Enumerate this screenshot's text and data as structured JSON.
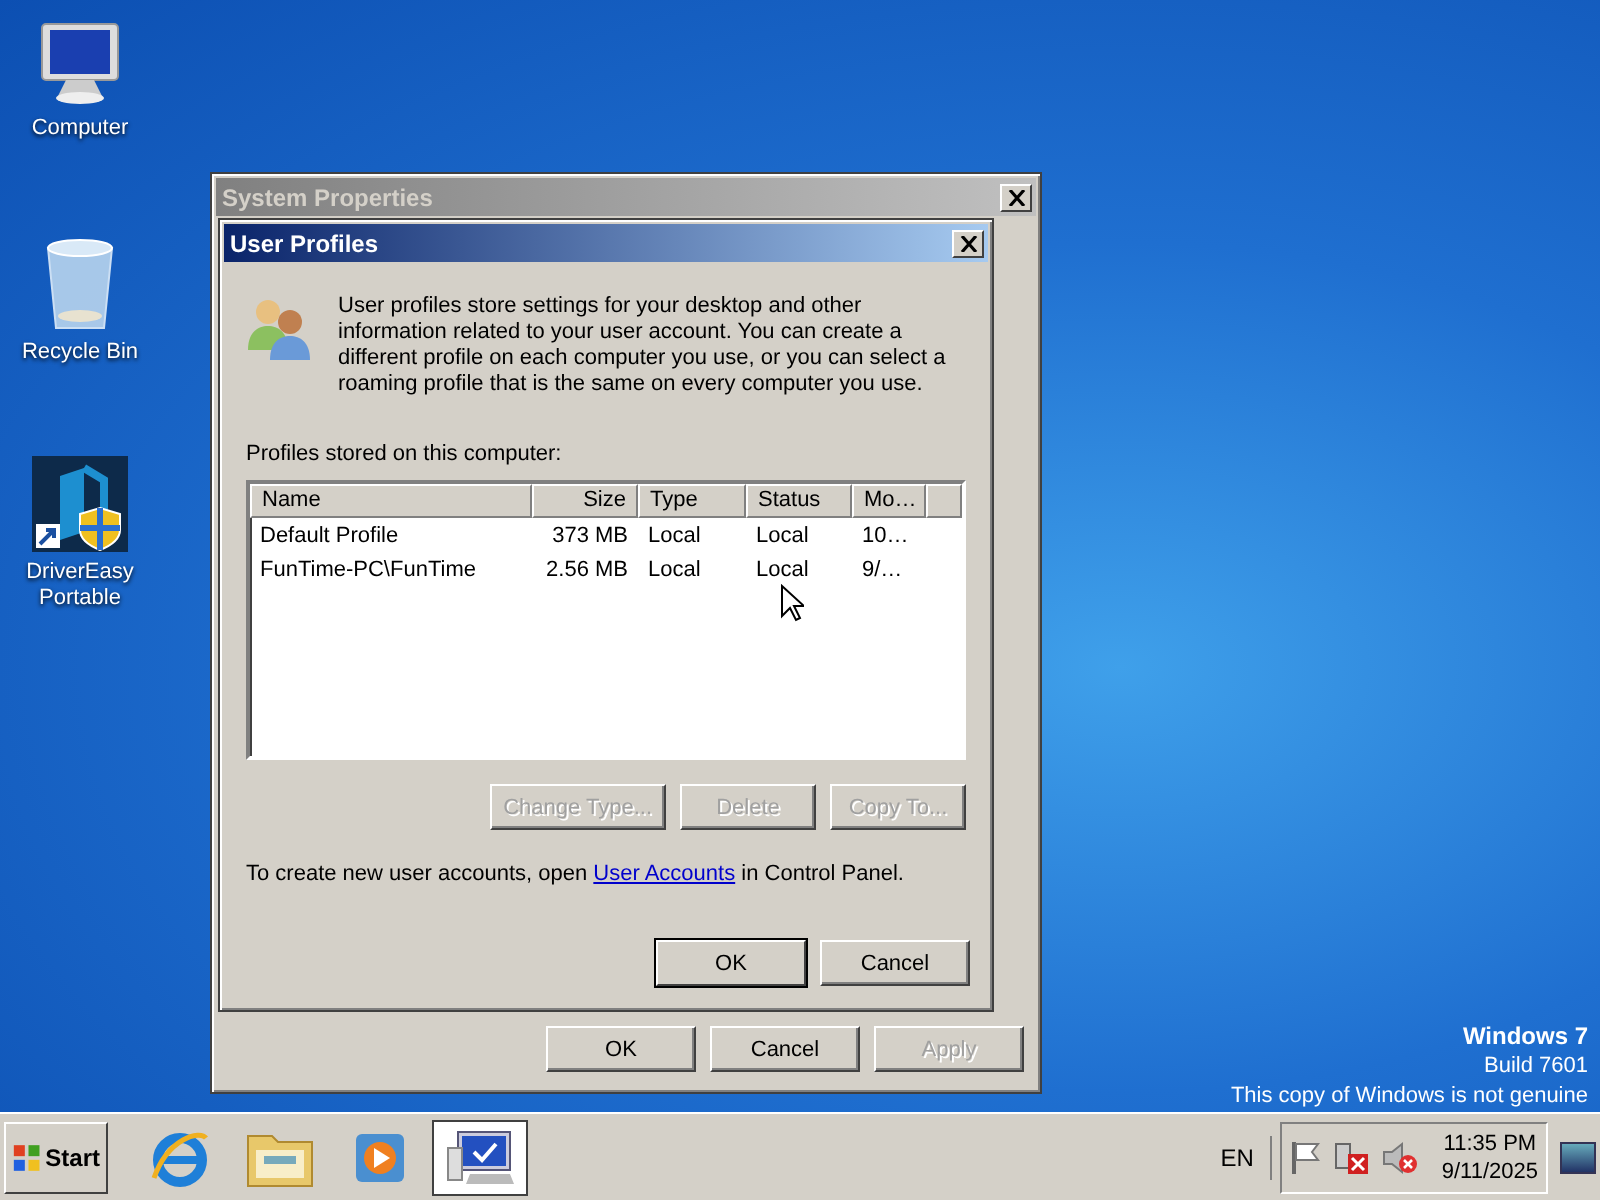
{
  "desktop_icons": [
    {
      "label": "Computer",
      "kind": "computer"
    },
    {
      "label": "Recycle Bin",
      "kind": "recycle"
    },
    {
      "label": "DriverEasy Portable",
      "kind": "shortcut"
    }
  ],
  "system_properties": {
    "title": "System Properties",
    "buttons": [
      {
        "label": "OK",
        "disabled": false
      },
      {
        "label": "Cancel",
        "disabled": false
      },
      {
        "label": "Apply",
        "disabled": true
      }
    ]
  },
  "dialog": {
    "title": "User Profiles",
    "description": "User profiles store settings for your desktop and other information related to your user account. You can create a different profile on each computer you use, or you can select a roaming profile that is the same on every computer you use.",
    "list_label": "Profiles stored on this computer:",
    "columns": [
      "Name",
      "Size",
      "Type",
      "Status",
      "Mo…"
    ],
    "rows": [
      [
        "Default Profile",
        "373 MB",
        "Local",
        "Local",
        "10…"
      ],
      [
        "FunTime-PC\\FunTime",
        "2.56 MB",
        "Local",
        "Local",
        "9/…"
      ]
    ],
    "action_buttons": [
      {
        "label": "Change Type...",
        "disabled": true
      },
      {
        "label": "Delete",
        "disabled": true
      },
      {
        "label": "Copy To...",
        "disabled": true
      }
    ],
    "footer": {
      "before": "To create new user accounts, open",
      "link": "User Accounts",
      "after": "in Control Panel."
    },
    "buttons": [
      {
        "label": "OK",
        "default": true
      },
      {
        "label": "Cancel",
        "default": false
      }
    ]
  },
  "watermark": [
    {
      "text": "Windows 7",
      "bold": true
    },
    {
      "text": "Build 7601",
      "bold": false
    },
    {
      "text": "This copy of Windows is not genuine",
      "bold": false
    }
  ],
  "taskbar": {
    "start": "Start",
    "apps": [
      {
        "kind": "browser",
        "selected": false
      },
      {
        "kind": "folder",
        "selected": false
      },
      {
        "kind": "media",
        "selected": false
      },
      {
        "kind": "system",
        "selected": true
      }
    ],
    "language": "EN",
    "time": "11:35 PM",
    "date": "9/11/2025"
  }
}
